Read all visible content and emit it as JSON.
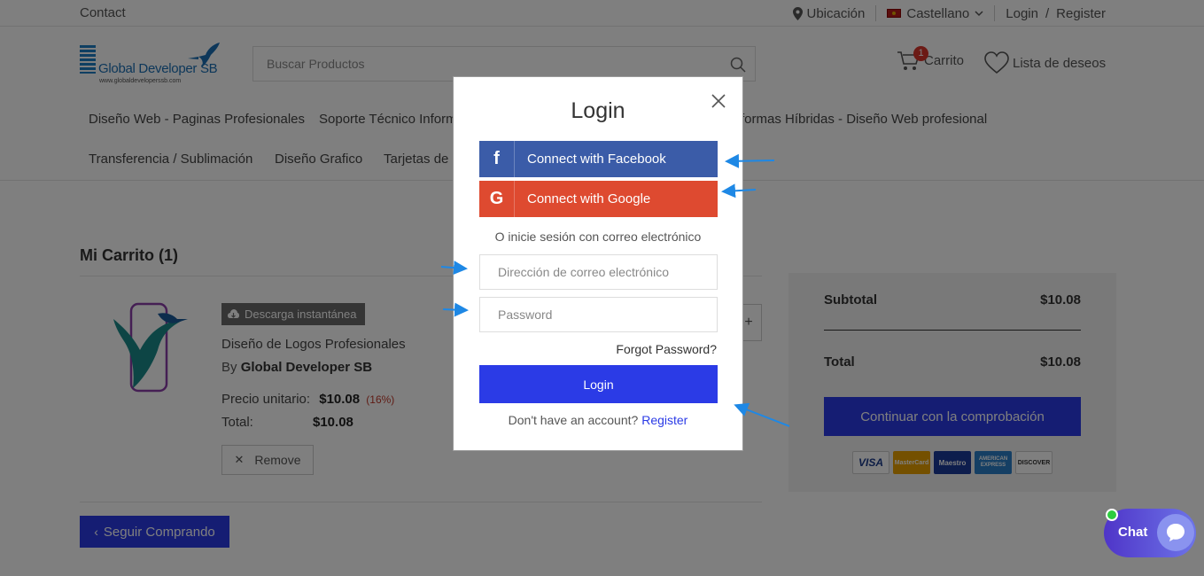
{
  "topbar": {
    "contact": "Contact",
    "location": "Ubicación",
    "language": "Castellano",
    "login": "Login",
    "divider": "/",
    "register": "Register"
  },
  "header": {
    "logo_brand": "Global Developer SB",
    "logo_url": "www.globaldeveloperssb.com",
    "search_placeholder": "Buscar Productos",
    "cart_label": "Carrito",
    "cart_count": "1",
    "wishlist_label": "Lista de deseos"
  },
  "nav": {
    "items": [
      "Diseño Web - Paginas Profesionales",
      "Soporte Técnico Informá",
      "formas Híbridas - Diseño Web profesional",
      "Transferencia / Sublimación",
      "Diseño Grafico",
      "Tarjetas de"
    ]
  },
  "cart": {
    "title": "Mi Carrito (1)",
    "badge": "Descarga instantánea",
    "product_name": "Diseño de Logos Profesionales",
    "by_prefix": "By",
    "seller": "Global Developer SB",
    "unit_price_label": "Precio unitario:",
    "unit_price": "$10.08",
    "discount": "(16%)",
    "total_label": "Total:",
    "total": "$10.08",
    "qty_plus": "+",
    "remove": "Remove",
    "continue": "Seguir Comprando"
  },
  "summary": {
    "subtotal_label": "Subtotal",
    "subtotal": "$10.08",
    "total_label": "Total",
    "total": "$10.08",
    "checkout": "Continuar con la comprobación",
    "cards": [
      "VISA",
      "MasterCard",
      "Maestro",
      "AMERICAN EXPRESS",
      "DISCOVER"
    ]
  },
  "modal": {
    "title": "Login",
    "facebook": "Connect with Facebook",
    "google": "Connect with Google",
    "or_text": "O inicie sesión con correo electrónico",
    "email_placeholder": "Dirección de correo electrónico",
    "password_placeholder": "Password",
    "forgot": "Forgot Password?",
    "login_button": "Login",
    "no_account": "Don't have an account?",
    "register": "Register"
  },
  "chat": {
    "label": "Chat"
  },
  "colors": {
    "primary": "#2b3be6",
    "facebook": "#3b5ca8",
    "google": "#de4a30",
    "annotation_arrow": "#1e88e5"
  }
}
